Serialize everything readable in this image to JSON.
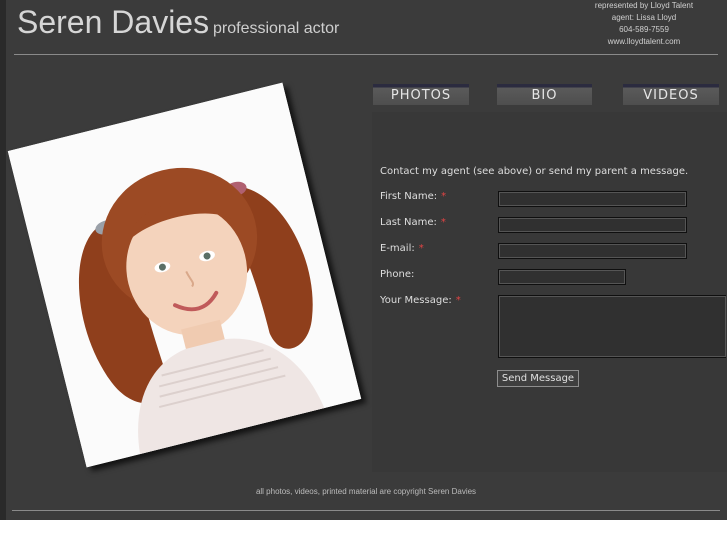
{
  "header": {
    "name": "Seren Davies",
    "tagline": "professional actor"
  },
  "agent": {
    "line1": "represented by Lloyd Talent",
    "line2": "agent: Lissa Lloyd",
    "phone": "604-589-7559",
    "website": "www.lloydtalent.com"
  },
  "nav": {
    "photos": "PHOTOS",
    "bio": "BIO",
    "videos": "VIDEOS"
  },
  "form": {
    "intro": "Contact my agent (see above) or send my parent a message.",
    "required_mark": "*",
    "first_name": "First Name:",
    "last_name": "Last Name:",
    "email": "E-mail:",
    "phone": "Phone:",
    "message": "Your Message:",
    "send": "Send Message"
  },
  "footer": {
    "copyright": "all photos, videos, printed material are copyright Seren Davies"
  },
  "colors": {
    "background": "#3b3b3b",
    "required": "#e24444"
  }
}
